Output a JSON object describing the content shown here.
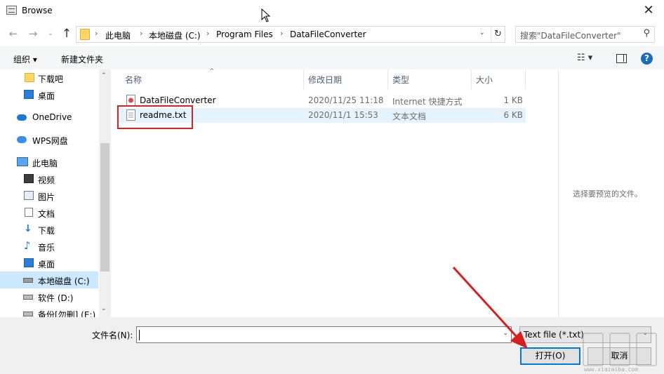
{
  "window": {
    "title": "Browse",
    "close_glyph": "✕"
  },
  "nav": {
    "back_icon": "←",
    "forward_icon": "→",
    "recent_icon": "⌄",
    "up_icon": "↑"
  },
  "address": {
    "crumbs": [
      "此电脑",
      "本地磁盘 (C:)",
      "Program Files",
      "DataFileConverter"
    ],
    "separator": "›",
    "dropdown_icon": "⌄",
    "refresh_icon": "↻"
  },
  "search": {
    "placeholder": "搜索\"DataFileConverter\"",
    "icon": "⚲"
  },
  "toolbar": {
    "organize": "组织 ▾",
    "new_folder": "新建文件夹",
    "view_icon": "☷ ▾",
    "help_label": "?"
  },
  "sidebar": {
    "items": [
      {
        "label": "下载吧",
        "icon": "folder-icon"
      },
      {
        "label": "桌面",
        "icon": "desktop-icon"
      },
      {
        "label": "OneDrive",
        "icon": "cloud-icon"
      },
      {
        "label": "WPS网盘",
        "icon": "wps-cloud-icon"
      },
      {
        "label": "此电脑",
        "icon": "computer-icon"
      },
      {
        "label": "视频",
        "icon": "video-icon"
      },
      {
        "label": "图片",
        "icon": "pictures-icon"
      },
      {
        "label": "文档",
        "icon": "documents-icon"
      },
      {
        "label": "下载",
        "icon": "download-icon"
      },
      {
        "label": "音乐",
        "icon": "music-icon"
      },
      {
        "label": "桌面",
        "icon": "desktop-icon"
      },
      {
        "label": "本地磁盘 (C:)",
        "icon": "drive-icon",
        "selected": true
      },
      {
        "label": "软件 (D:)",
        "icon": "drive-icon"
      },
      {
        "label": "备份[勿删] (E:)",
        "icon": "drive-icon"
      }
    ],
    "scroll_up": "⌃",
    "scroll_down": "⌄"
  },
  "columns": {
    "name": "名称",
    "modified": "修改日期",
    "type": "类型",
    "size": "大小",
    "sort_caret": "^"
  },
  "files": [
    {
      "name": "DataFileConverter",
      "modified": "2020/11/25 11:18",
      "type": "Internet 快捷方式",
      "size": "1 KB",
      "icon": "shortcut-icon"
    },
    {
      "name": "readme.txt",
      "modified": "2020/11/1 15:53",
      "type": "文本文档",
      "size": "6 KB",
      "icon": "text-file-icon"
    }
  ],
  "preview": {
    "message": "选择要预览的文件。"
  },
  "footer": {
    "filename_label": "文件名(N):",
    "filename_value": "",
    "filetype": "Text file (*.txt)",
    "open_button": "打开(O)",
    "cancel_button": "取消",
    "dropdown_icon": "⌄"
  },
  "watermark": {
    "url": "www.xiazaiba.com"
  },
  "colors": {
    "accent": "#0078d7",
    "annotation": "#e02020",
    "selected_bg": "#cce8ff",
    "hover_bg": "#e5f3ff"
  }
}
